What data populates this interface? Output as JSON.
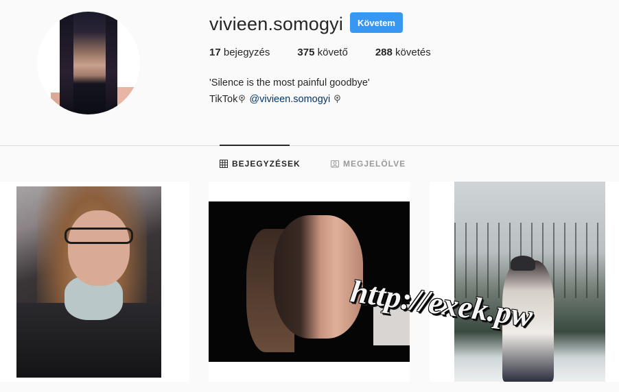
{
  "profile": {
    "username": "vivieen.somogyi",
    "follow_label": "Követem",
    "stats": {
      "posts_count": "17",
      "posts_label": "bejegyzés",
      "followers_count": "375",
      "followers_label": "követő",
      "following_count": "288",
      "following_label": "követés"
    },
    "bio": {
      "line1": "'Silence is the most painful goodbye'",
      "line2_prefix": "TikTok",
      "line2_link": "@vivieen.somogyi"
    }
  },
  "tabs": [
    {
      "label": "BEJEGYZÉSEK",
      "icon": "grid-icon",
      "active": true
    },
    {
      "label": "MEGJELÖLVE",
      "icon": "tagged-icon",
      "active": false
    }
  ],
  "posts": [
    {
      "alt": "selfie in car with glasses"
    },
    {
      "alt": "close-up portrait in shadow"
    },
    {
      "alt": "winter park photo"
    }
  ],
  "watermark": "http://exek.pw",
  "colors": {
    "accent": "#3897f0",
    "link": "#003569",
    "background": "#fafafa",
    "divider": "#dbdbdb"
  }
}
